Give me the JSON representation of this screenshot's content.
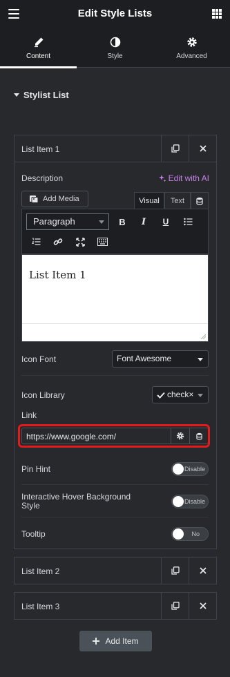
{
  "header": {
    "title": "Edit Style Lists",
    "menu_icon": "hamburger-icon",
    "apps_icon": "grid-icon"
  },
  "tabs": [
    {
      "label": "Content",
      "icon": "pencil-icon",
      "active": true
    },
    {
      "label": "Style",
      "icon": "half-circle-icon",
      "active": false
    },
    {
      "label": "Advanced",
      "icon": "gear-icon",
      "active": false
    }
  ],
  "section": {
    "title": "Stylist List"
  },
  "items": [
    {
      "label": "List Item 1"
    },
    {
      "label": "List Item 2"
    },
    {
      "label": "List Item 3"
    }
  ],
  "description": {
    "label": "Description",
    "ai_label": "Edit with AI",
    "add_media": "Add Media",
    "tab_visual": "Visual",
    "tab_text": "Text",
    "format_select": "Paragraph",
    "content": "List Item 1"
  },
  "icon_font": {
    "label": "Icon Font",
    "value": "Font Awesome"
  },
  "icon_library": {
    "label": "Icon Library",
    "value": "check×"
  },
  "link": {
    "label": "Link",
    "value": "https://www.google.com/"
  },
  "pin_hint": {
    "label": "Pin Hint",
    "state": "Disable"
  },
  "hover_bg": {
    "label": "Interactive Hover Background Style",
    "state": "Disable"
  },
  "tooltip": {
    "label": "Tooltip",
    "state": "No"
  },
  "add_item": {
    "label": "Add Item"
  },
  "colors": {
    "accent_ai": "#c680e6",
    "highlight": "#e31b1b",
    "panel": "#27292d"
  }
}
